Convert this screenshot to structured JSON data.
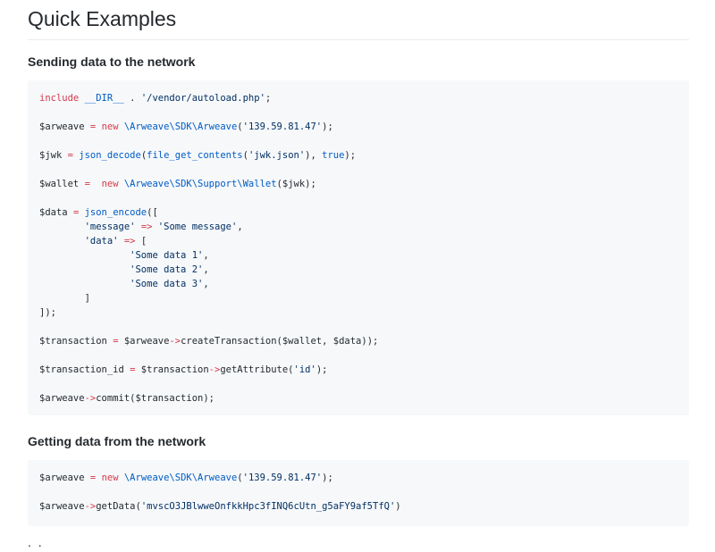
{
  "page": {
    "title": "Quick Examples"
  },
  "sections": [
    {
      "heading": "Sending data to the network",
      "lines": [
        [
          [
            "k",
            "include"
          ],
          [
            "p",
            " "
          ],
          [
            "f",
            "__DIR__"
          ],
          [
            "p",
            " . "
          ],
          [
            "s",
            "'/vendor/autoload.php'"
          ],
          [
            "p",
            ";"
          ]
        ],
        [],
        [
          [
            "p",
            "$arweave "
          ],
          [
            "k",
            "="
          ],
          [
            "p",
            " "
          ],
          [
            "k",
            "new"
          ],
          [
            "p",
            " "
          ],
          [
            "ns",
            "\\Arweave\\SDK\\Arweave"
          ],
          [
            "p",
            "("
          ],
          [
            "s",
            "'139.59.81.47'"
          ],
          [
            "p",
            ");"
          ]
        ],
        [],
        [
          [
            "p",
            "$jwk "
          ],
          [
            "k",
            "="
          ],
          [
            "p",
            " "
          ],
          [
            "f",
            "json_decode"
          ],
          [
            "p",
            "("
          ],
          [
            "f",
            "file_get_contents"
          ],
          [
            "p",
            "("
          ],
          [
            "s",
            "'jwk.json'"
          ],
          [
            "p",
            "), "
          ],
          [
            "f",
            "true"
          ],
          [
            "p",
            ");"
          ]
        ],
        [],
        [
          [
            "p",
            "$wallet "
          ],
          [
            "k",
            "="
          ],
          [
            "p",
            "  "
          ],
          [
            "k",
            "new"
          ],
          [
            "p",
            " "
          ],
          [
            "ns",
            "\\Arweave\\SDK\\Support\\Wallet"
          ],
          [
            "p",
            "($jwk);"
          ]
        ],
        [],
        [
          [
            "p",
            "$data "
          ],
          [
            "k",
            "="
          ],
          [
            "p",
            " "
          ],
          [
            "f",
            "json_encode"
          ],
          [
            "p",
            "(["
          ]
        ],
        [
          [
            "p",
            "        "
          ],
          [
            "s",
            "'message'"
          ],
          [
            "p",
            " "
          ],
          [
            "k",
            "=>"
          ],
          [
            "p",
            " "
          ],
          [
            "s",
            "'Some message'"
          ],
          [
            "p",
            ","
          ]
        ],
        [
          [
            "p",
            "        "
          ],
          [
            "s",
            "'data'"
          ],
          [
            "p",
            " "
          ],
          [
            "k",
            "=>"
          ],
          [
            "p",
            " ["
          ]
        ],
        [
          [
            "p",
            "                "
          ],
          [
            "s",
            "'Some data 1'"
          ],
          [
            "p",
            ","
          ]
        ],
        [
          [
            "p",
            "                "
          ],
          [
            "s",
            "'Some data 2'"
          ],
          [
            "p",
            ","
          ]
        ],
        [
          [
            "p",
            "                "
          ],
          [
            "s",
            "'Some data 3'"
          ],
          [
            "p",
            ","
          ]
        ],
        [
          [
            "p",
            "        ]"
          ]
        ],
        [
          [
            "p",
            "]);"
          ]
        ],
        [],
        [
          [
            "p",
            "$transaction "
          ],
          [
            "k",
            "="
          ],
          [
            "p",
            " $arweave"
          ],
          [
            "k",
            "->"
          ],
          [
            "p",
            "createTransaction($wallet, $data));"
          ]
        ],
        [],
        [
          [
            "p",
            "$transaction_id "
          ],
          [
            "k",
            "="
          ],
          [
            "p",
            " $transaction"
          ],
          [
            "k",
            "->"
          ],
          [
            "p",
            "getAttribute("
          ],
          [
            "s",
            "'id'"
          ],
          [
            "p",
            ");"
          ]
        ],
        [],
        [
          [
            "p",
            "$arweave"
          ],
          [
            "k",
            "->"
          ],
          [
            "p",
            "commit($transaction);"
          ]
        ]
      ]
    },
    {
      "heading": "Getting data from the network",
      "lines": [
        [
          [
            "p",
            "$arweave "
          ],
          [
            "k",
            "="
          ],
          [
            "p",
            " "
          ],
          [
            "k",
            "new"
          ],
          [
            "p",
            " "
          ],
          [
            "ns",
            "\\Arweave\\SDK\\Arweave"
          ],
          [
            "p",
            "("
          ],
          [
            "s",
            "'139.59.81.47'"
          ],
          [
            "p",
            ");"
          ]
        ],
        [],
        [
          [
            "p",
            "$arweave"
          ],
          [
            "k",
            "->"
          ],
          [
            "p",
            "getData("
          ],
          [
            "s",
            "'mvscO3JBlwweOnfkkHpc3fINQ6cUtn_g5aFY9af5TfQ'"
          ],
          [
            "p",
            ")"
          ]
        ]
      ]
    }
  ],
  "more_text": ". ."
}
